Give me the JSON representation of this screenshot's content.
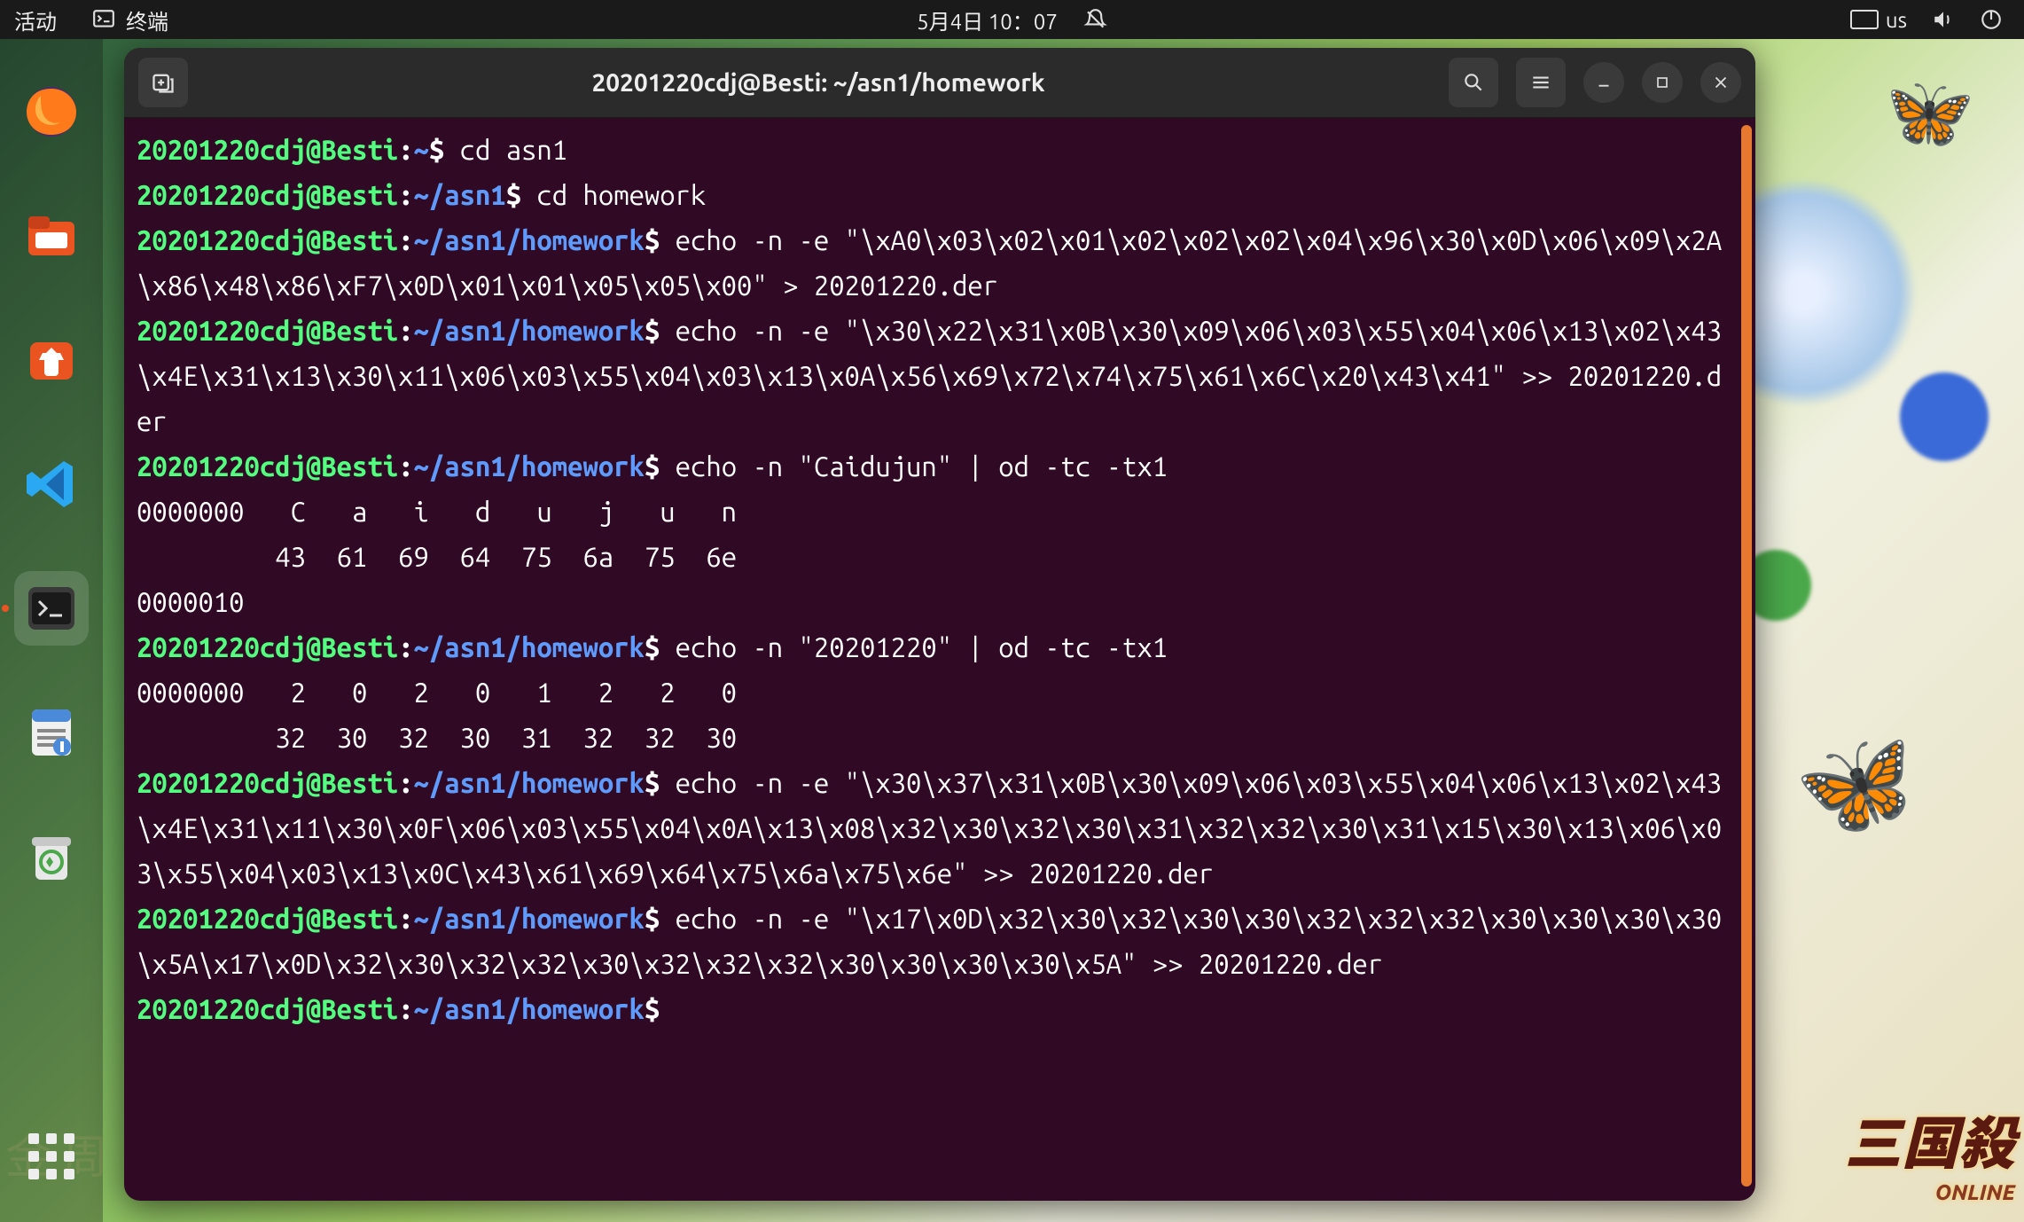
{
  "topbar": {
    "activities": "活动",
    "app_label": "终端",
    "datetime": "5月4日  10：07",
    "ime_label": "us"
  },
  "dock": {
    "items": [
      {
        "name": "firefox"
      },
      {
        "name": "files"
      },
      {
        "name": "software-store"
      },
      {
        "name": "vscode"
      },
      {
        "name": "terminal"
      },
      {
        "name": "gedit"
      },
      {
        "name": "trash"
      }
    ]
  },
  "window": {
    "title": "20201220cdj@Besti: ~/asn1/homework"
  },
  "terminal": {
    "lines": [
      {
        "type": "prompt",
        "user": "20201220cdj@Besti",
        "path": "~",
        "cmd": "cd asn1"
      },
      {
        "type": "prompt",
        "user": "20201220cdj@Besti",
        "path": "~/asn1",
        "cmd": "cd homework"
      },
      {
        "type": "prompt",
        "user": "20201220cdj@Besti",
        "path": "~/asn1/homework",
        "cmd": "echo -n -e \"\\xA0\\x03\\x02\\x01\\x02\\x02\\x02\\x04\\x96\\x30\\x0D\\x06\\x09\\x2A\\x86\\x48\\x86\\xF7\\x0D\\x01\\x01\\x05\\x05\\x00\" > 20201220.der"
      },
      {
        "type": "prompt",
        "user": "20201220cdj@Besti",
        "path": "~/asn1/homework",
        "cmd": "echo -n -e \"\\x30\\x22\\x31\\x0B\\x30\\x09\\x06\\x03\\x55\\x04\\x06\\x13\\x02\\x43\\x4E\\x31\\x13\\x30\\x11\\x06\\x03\\x55\\x04\\x03\\x13\\x0A\\x56\\x69\\x72\\x74\\x75\\x61\\x6C\\x20\\x43\\x41\" >> 20201220.der"
      },
      {
        "type": "prompt",
        "user": "20201220cdj@Besti",
        "path": "~/asn1/homework",
        "cmd": "echo -n \"Caidujun\" | od -tc -tx1"
      },
      {
        "type": "output",
        "text": "0000000   C   a   i   d   u   j   u   n"
      },
      {
        "type": "output",
        "text": "         43  61  69  64  75  6a  75  6e"
      },
      {
        "type": "output",
        "text": "0000010"
      },
      {
        "type": "prompt",
        "user": "20201220cdj@Besti",
        "path": "~/asn1/homework",
        "cmd": "echo -n \"20201220\" | od -tc -tx1"
      },
      {
        "type": "output",
        "text": "0000000   2   0   2   0   1   2   2   0"
      },
      {
        "type": "output",
        "text": "         32  30  32  30  31  32  32  30"
      },
      {
        "type": "prompt",
        "user": "20201220cdj@Besti",
        "path": "~/asn1/homework",
        "cmd": "echo -n -e \"\\x30\\x37\\x31\\x0B\\x30\\x09\\x06\\x03\\x55\\x04\\x06\\x13\\x02\\x43\\x4E\\x31\\x11\\x30\\x0F\\x06\\x03\\x55\\x04\\x0A\\x13\\x08\\x32\\x30\\x32\\x30\\x31\\x32\\x32\\x30\\x31\\x15\\x30\\x13\\x06\\x03\\x55\\x04\\x03\\x13\\x0C\\x43\\x61\\x69\\x64\\x75\\x6a\\x75\\x6e\" >> 20201220.der"
      },
      {
        "type": "prompt",
        "user": "20201220cdj@Besti",
        "path": "~/asn1/homework",
        "cmd": "echo -n -e \"\\x17\\x0D\\x32\\x30\\x32\\x30\\x30\\x32\\x32\\x32\\x30\\x30\\x30\\x30\\x5A\\x17\\x0D\\x32\\x30\\x32\\x32\\x30\\x32\\x32\\x32\\x30\\x30\\x30\\x30\\x5A\" >> 20201220.der"
      },
      {
        "type": "prompt",
        "user": "20201220cdj@Besti",
        "path": "~/asn1/homework",
        "cmd": ""
      }
    ]
  },
  "watermark": {
    "main": "三国殺",
    "sub": "ONLINE"
  },
  "desktop_hint": "金    周"
}
